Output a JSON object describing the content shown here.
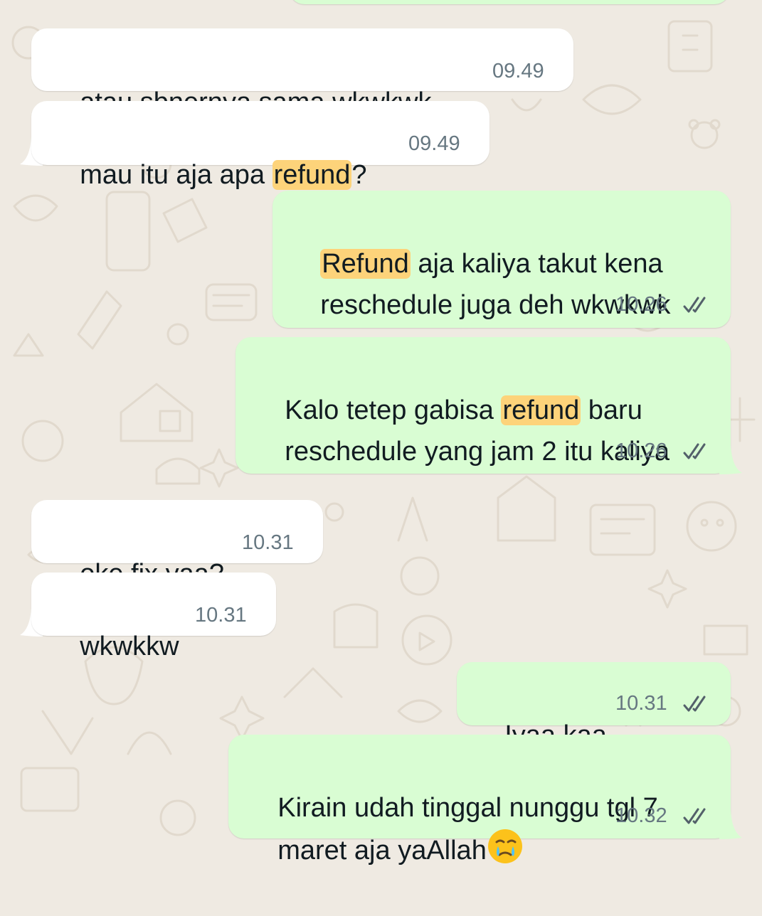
{
  "colors": {
    "wallpaper": "#efeae2",
    "incoming_bubble": "#ffffff",
    "outgoing_bubble": "#d9fdd3",
    "search_highlight": "#fdd37a",
    "meta_text": "#667781",
    "read_ticks": "#53606a"
  },
  "messages": [
    {
      "direction": "incoming",
      "lines": [
        [
          {
            "text": "atau sbnernya sama wkwkwk"
          }
        ]
      ],
      "time": "09.49"
    },
    {
      "direction": "incoming",
      "lines": [
        [
          {
            "text": "mau itu aja apa "
          },
          {
            "text": "refund",
            "highlight": true
          },
          {
            "text": "?"
          }
        ]
      ],
      "time": "09.49"
    },
    {
      "direction": "outgoing",
      "lines": [
        [
          {
            "text": "Refund",
            "highlight": true
          },
          {
            "text": " aja kaliya takut kena"
          }
        ],
        [
          {
            "text": "reschedule juga deh wkwkwk"
          }
        ]
      ],
      "time": "10.26",
      "status_icon": "double-check-read-icon"
    },
    {
      "direction": "outgoing",
      "lines": [
        [
          {
            "text": "Kalo tetep gabisa "
          },
          {
            "text": "refund",
            "highlight": true
          },
          {
            "text": " baru"
          }
        ],
        [
          {
            "text": "reschedule yang jam 2 itu kaliya"
          }
        ]
      ],
      "time": "10.26",
      "status_icon": "double-check-read-icon"
    },
    {
      "direction": "incoming",
      "lines": [
        [
          {
            "text": "oke fix yaa?"
          }
        ]
      ],
      "time": "10.31"
    },
    {
      "direction": "incoming",
      "lines": [
        [
          {
            "text": "wkwkkw"
          }
        ]
      ],
      "time": "10.31"
    },
    {
      "direction": "outgoing",
      "lines": [
        [
          {
            "text": "Iyaa kaa"
          }
        ]
      ],
      "time": "10.31",
      "status_icon": "double-check-read-icon"
    },
    {
      "direction": "outgoing",
      "lines": [
        [
          {
            "text": "Kirain udah tinggal nunggu tgl 7"
          }
        ],
        [
          {
            "text": "maret aja yaAllah"
          },
          {
            "emoji": "face-holding-back-tears-emoji"
          }
        ]
      ],
      "time": "10.32",
      "status_icon": "double-check-read-icon"
    }
  ]
}
